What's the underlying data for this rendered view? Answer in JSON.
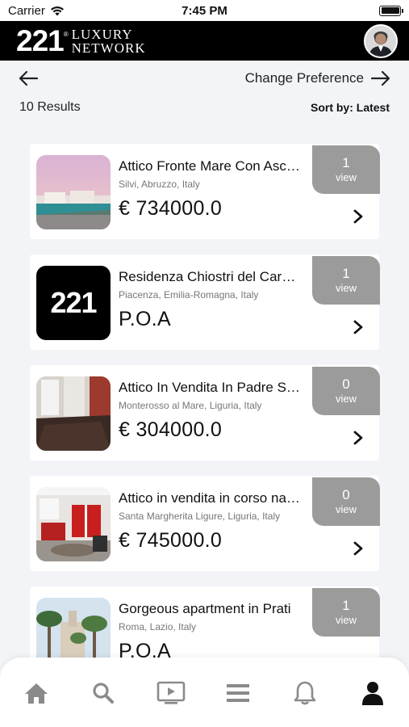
{
  "status_bar": {
    "carrier": "Carrier",
    "time": "7:45 PM"
  },
  "header": {
    "logo_number": "221",
    "logo_reg": "®",
    "logo_line1": "LUXURY",
    "logo_line2": "NETWORK"
  },
  "nav": {
    "change_preference": "Change Preference"
  },
  "results": {
    "count_label": "10 Results",
    "sort_label": "Sort by: Latest"
  },
  "listings": [
    {
      "title": "Attico Fronte Mare Con Ascensore",
      "location": "Silvi, Abruzzo, Italy",
      "price": "€ 734000.0",
      "views": "1",
      "view_label": "view",
      "image": "seaside-photo"
    },
    {
      "title": "Residenza Chiostri del Carmine",
      "location": "Piacenza, Emilia-Romagna, Italy",
      "price": "P.O.A",
      "views": "1",
      "view_label": "view",
      "image": "221-logo-placeholder",
      "placeholder_text": "221"
    },
    {
      "title": "Attico In Vendita In Padre Semeria",
      "location": "Monterosso al Mare, Liguria, Italy",
      "price": "€ 304000.0",
      "views": "0",
      "view_label": "view",
      "image": "interior-photo"
    },
    {
      "title": "Attico in vendita in corso nazionale",
      "location": "Santa Margherita Ligure, Liguria, Italy",
      "price": "€ 745000.0",
      "views": "0",
      "view_label": "view",
      "image": "kitchen-photo"
    },
    {
      "title": "Gorgeous apartment in Prati",
      "location": "Roma, Lazio, Italy",
      "price": "P.O.A",
      "views": "1",
      "view_label": "view",
      "image": "palm-street-photo"
    }
  ],
  "tab_bar": {
    "items": [
      {
        "icon": "home-icon"
      },
      {
        "icon": "search-icon"
      },
      {
        "icon": "video-icon"
      },
      {
        "icon": "menu-icon"
      },
      {
        "icon": "bell-icon"
      },
      {
        "icon": "profile-icon",
        "active": true
      }
    ]
  },
  "colors": {
    "header_bg": "#000000",
    "badge_bg": "#9b9b9b",
    "tab_inactive": "#8a8a8a",
    "tab_active": "#111111"
  }
}
